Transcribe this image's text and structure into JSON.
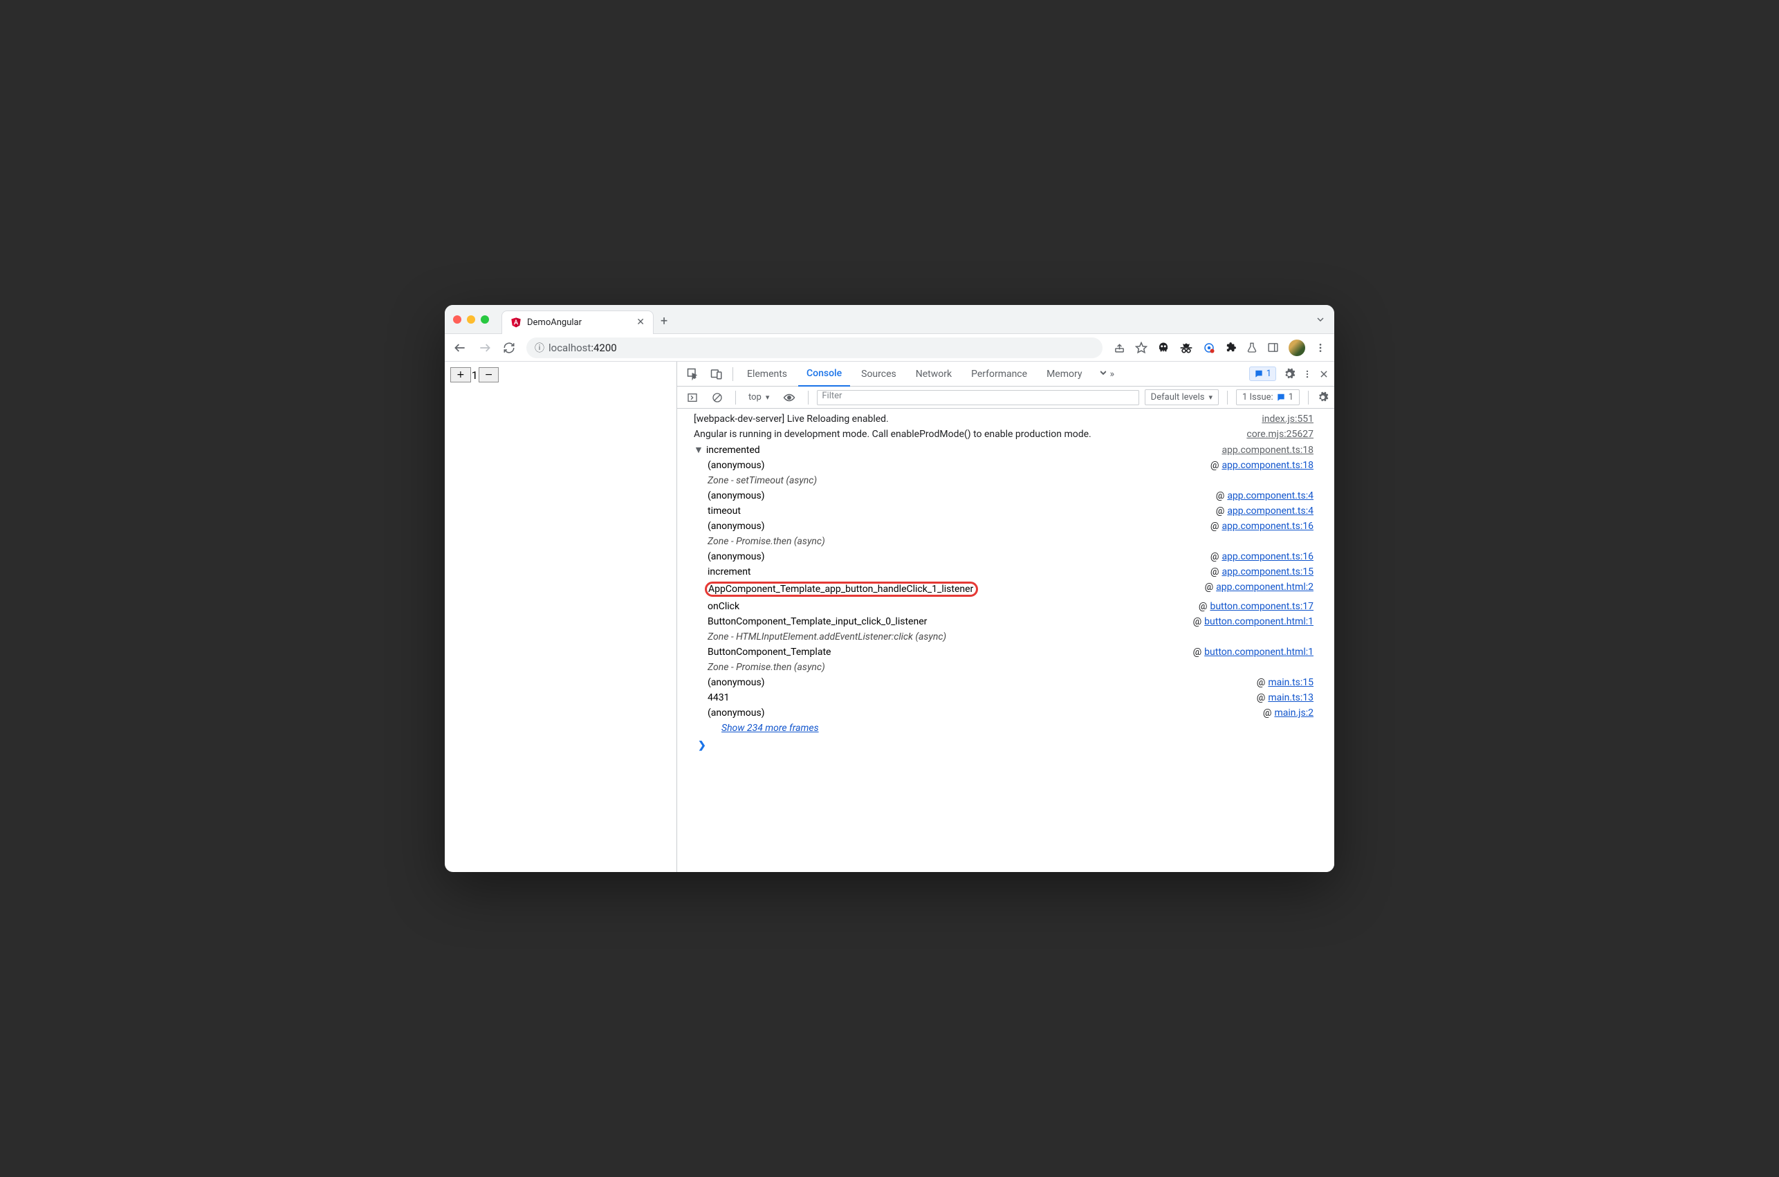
{
  "window": {
    "tab_title": "DemoAngular",
    "url_host": "localhost",
    "url_port": ":4200"
  },
  "page": {
    "plus": "+",
    "minus": "−",
    "count": "1"
  },
  "devtools": {
    "tabs": [
      "Elements",
      "Console",
      "Sources",
      "Network",
      "Performance",
      "Memory"
    ],
    "active_tab": "Console",
    "issues_count": "1",
    "console_bar": {
      "context": "top",
      "filter_placeholder": "Filter",
      "levels": "Default levels",
      "issues_label": "1 Issue:",
      "issues_count": "1"
    }
  },
  "console": {
    "log1": {
      "msg": "[webpack-dev-server] Live Reloading enabled.",
      "src": "index.js:551"
    },
    "log2": {
      "msg": "Angular is running in development mode. Call enableProdMode() to enable production mode.",
      "src": "core.mjs:25627"
    },
    "trace": {
      "title": "incremented",
      "src": "app.component.ts:18",
      "frames": [
        {
          "name": "(anonymous)",
          "link": "app.component.ts:18"
        },
        {
          "name": "Zone - setTimeout (async)",
          "zone": true
        },
        {
          "name": "(anonymous)",
          "link": "app.component.ts:4"
        },
        {
          "name": "timeout",
          "link": "app.component.ts:4"
        },
        {
          "name": "(anonymous)",
          "link": "app.component.ts:16"
        },
        {
          "name": "Zone - Promise.then (async)",
          "zone": true
        },
        {
          "name": "(anonymous)",
          "link": "app.component.ts:16"
        },
        {
          "name": "increment",
          "link": "app.component.ts:15"
        },
        {
          "name": "AppComponent_Template_app_button_handleClick_1_listener",
          "link": "app.component.html:2",
          "highlight": true
        },
        {
          "name": "onClick",
          "link": "button.component.ts:17"
        },
        {
          "name": "ButtonComponent_Template_input_click_0_listener",
          "link": "button.component.html:1"
        },
        {
          "name": "Zone - HTMLInputElement.addEventListener:click (async)",
          "zone": true
        },
        {
          "name": "ButtonComponent_Template",
          "link": "button.component.html:1"
        },
        {
          "name": "Zone - Promise.then (async)",
          "zone": true
        },
        {
          "name": "(anonymous)",
          "link": "main.ts:15"
        },
        {
          "name": "4431",
          "link": "main.ts:13"
        },
        {
          "name": "(anonymous)",
          "link": "main.js:2"
        }
      ],
      "show_more": "Show 234 more frames"
    }
  }
}
